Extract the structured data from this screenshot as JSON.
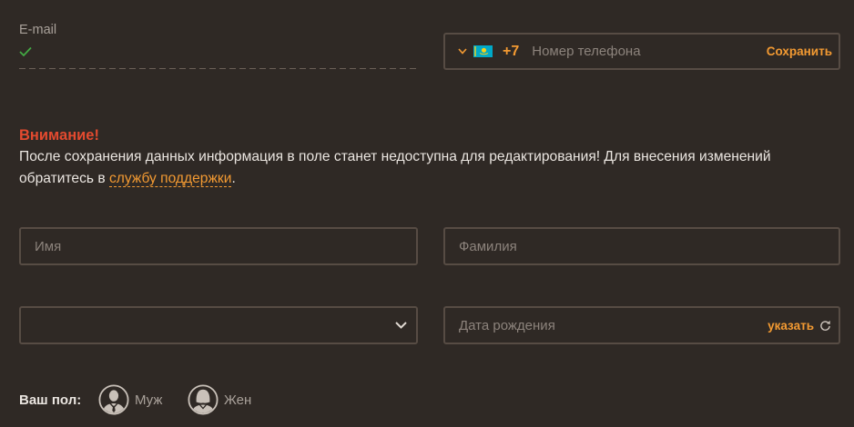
{
  "colors": {
    "background": "#2f2925",
    "border": "#574c44",
    "placeholder": "#8c837c",
    "text": "#ebe6e1",
    "label": "#a9a19a",
    "accent": "#f39a32",
    "warning": "#e34a2f",
    "success": "#43a944",
    "icon": "#c9c1b9"
  },
  "email": {
    "label": "E-mail",
    "status_icon": "check-icon"
  },
  "phone": {
    "toggle_icon": "chevron-down-icon",
    "flag_icon": "kazakhstan-flag-icon",
    "country_code": "+7",
    "value": "",
    "placeholder": "Номер телефона",
    "save_label": "Сохранить"
  },
  "warning": {
    "title": "Внимание!",
    "text": "После сохранения данных информация в поле станет недоступна для редактирования! Для внесения изменений обратитесь в ",
    "link": "службу поддержки",
    "suffix": "."
  },
  "first_name": {
    "value": "",
    "placeholder": "Имя"
  },
  "last_name": {
    "value": "",
    "placeholder": "Фамилия"
  },
  "select": {
    "value": "",
    "toggle_icon": "chevron-down-icon"
  },
  "birth_date": {
    "value": "",
    "placeholder": "Дата рождения",
    "action_label": "указать",
    "action_icon": "refresh-icon"
  },
  "gender": {
    "label": "Ваш пол:",
    "options": [
      {
        "label": "Муж",
        "icon": "male-avatar-icon"
      },
      {
        "label": "Жен",
        "icon": "female-avatar-icon"
      }
    ]
  }
}
